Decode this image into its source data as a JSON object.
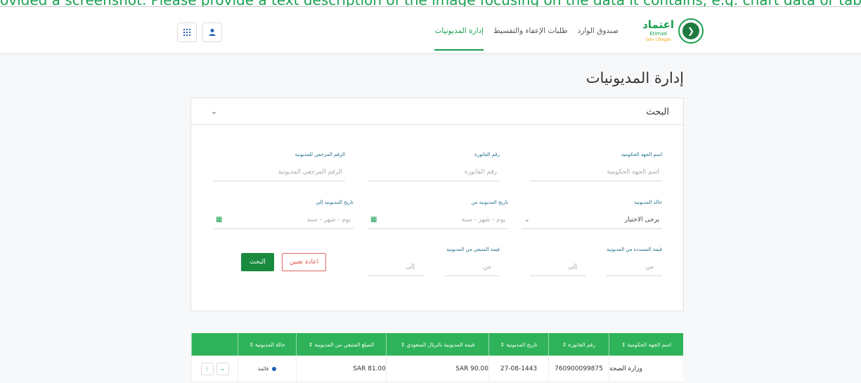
{
  "banner_text": "ovided a screenshot. Please provide a text description of the image focusing on the data it contains, e.g. chart data or tables. Produce this description in English. Use clear markdown format.",
  "brand": {
    "name_ar": "اعتماد",
    "name_en": "Etimad",
    "tagline": "Gov | Bagas"
  },
  "nav": [
    "إدارة المديونيات",
    "طلبات الإعفاء والتقسيط",
    "صندوق الوارد"
  ],
  "page_title": "إدارة المديونيات",
  "search": {
    "title": "البحث",
    "fields": {
      "gov_name": {
        "label": "اسم الجهة الحكومية",
        "placeholder": "اسم الجهة الحكومية"
      },
      "invoice": {
        "label": "رقم الفاتورة",
        "placeholder": "رقم الفاتورة"
      },
      "ref": {
        "label": "الرقم المرجعي للمديونية",
        "placeholder": "الرقم المرجعي المديونية"
      },
      "status": {
        "label": "حالة المديونية",
        "value": "يرجى الاختيار"
      },
      "date_from": {
        "label": "تاريخ المديونية من",
        "placeholder": "يوم - شهر - سنة"
      },
      "date_to": {
        "label": "تاريخ المديونية إلى",
        "placeholder": "يوم - شهر - سنة"
      },
      "paid": {
        "label": "قيمة المسددة من المديونية",
        "from": "من",
        "to": "إلى"
      },
      "remaining": {
        "label": "قيمة المتبقي من المديونية",
        "from": "من",
        "to": "إلى"
      }
    },
    "reset_label": "اعادة تعيين",
    "search_label": "البحث"
  },
  "table": {
    "headers": [
      "اسم الجهة الحكومية ⇕",
      "رقم الفاتورة ⇕",
      "تاريخ المديونية ⇕",
      "قيمة المديونية بالريال السعودي ⇕",
      "المبلغ المتبقي من المديونية ⇕",
      "حالة المديونية ⇕",
      ""
    ],
    "rows": [
      {
        "gov": "وزارة الصحة",
        "invoice": "760900099875",
        "date": "27-08-1443",
        "amount": "SAR 90.00",
        "remaining": "SAR 81.00",
        "status": "قائمة"
      }
    ]
  }
}
